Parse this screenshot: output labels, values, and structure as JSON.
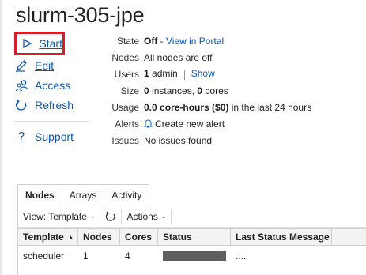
{
  "title": "slurm-305-jpe",
  "actions": {
    "start": "Start",
    "edit": "Edit",
    "access": "Access",
    "refresh": "Refresh",
    "support": "Support"
  },
  "info": {
    "state_label": "State",
    "state_value": "Off",
    "state_sep": " - ",
    "state_link": "View in Portal",
    "nodes_label": "Nodes",
    "nodes_value": "All nodes are off",
    "users_label": "Users",
    "users_count": "1",
    "users_unit": " admin",
    "users_link": "Show",
    "size_label": "Size",
    "size_instances": "0",
    "size_instances_unit": " instances, ",
    "size_cores": "0",
    "size_cores_unit": " cores",
    "usage_label": "Usage",
    "usage_value": "0.0 core-hours ($0)",
    "usage_suffix": " in the last 24 hours",
    "alerts_label": "Alerts",
    "alerts_link": "Create new alert",
    "issues_label": "Issues",
    "issues_value": "No issues found"
  },
  "tabs": [
    "Nodes",
    "Arrays",
    "Activity"
  ],
  "toolbar": {
    "view": "View: Template",
    "actions": "Actions"
  },
  "table": {
    "headers": [
      "Template",
      "Nodes",
      "Cores",
      "Status",
      "Last Status Message"
    ],
    "rows": [
      {
        "template": "scheduler",
        "nodes": "1",
        "cores": "4",
        "message": "...."
      }
    ]
  }
}
